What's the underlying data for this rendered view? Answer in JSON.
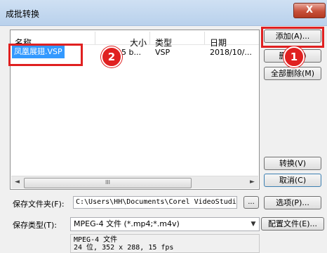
{
  "window": {
    "title": "成批转换",
    "close_symbol": "X"
  },
  "list": {
    "columns": [
      "名称",
      "大小",
      "类型",
      "日期"
    ],
    "rows": [
      {
        "name": "凤凰展翅.VSP",
        "size": "5 b...",
        "type": "VSP",
        "date": "2018/10/..."
      }
    ],
    "scroll_grip": "III",
    "scroll_left": "◄",
    "scroll_right": "►"
  },
  "buttons": {
    "add": "添加(A)...",
    "delete": "删除(D)",
    "delete_all": "全部删除(M)",
    "convert": "转换(V)",
    "cancel": "取消(C)",
    "options": "选项(P)...",
    "profile": "配置文件(E)..."
  },
  "form": {
    "save_folder_label": "保存文件夹(F):",
    "save_folder_value": "C:\\Users\\HH\\Documents\\Corel VideoStudio",
    "browse": "...",
    "save_type_label": "保存类型(T):",
    "save_type_value": "MPEG-4 文件 (*.mp4;*.m4v)",
    "info": "MPEG-4 文件\n24 位, 352 x 288, 15 fps"
  },
  "annotations": {
    "badge1": "1",
    "badge2": "2",
    "accent": "#e02020"
  }
}
